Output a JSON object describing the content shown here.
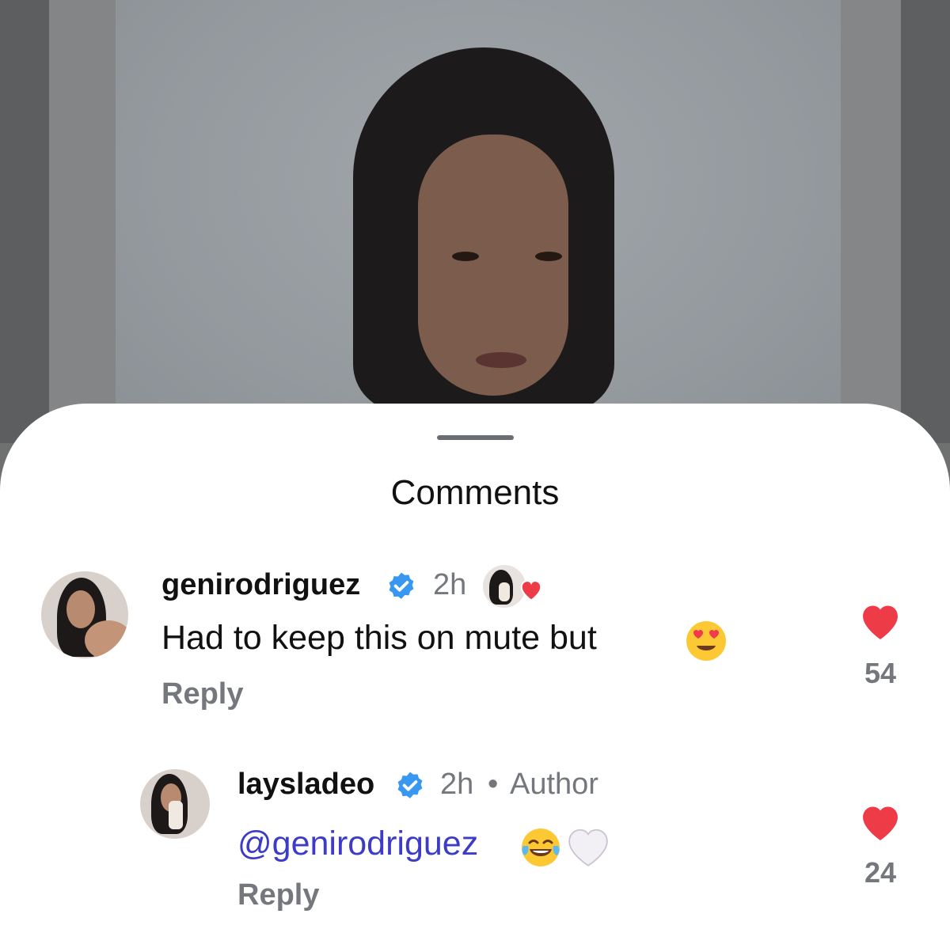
{
  "sheet": {
    "title": "Comments"
  },
  "comments": [
    {
      "username": "genirodriguez",
      "time": "2h",
      "text": "Had to keep this on mute but",
      "emoji": "heart-eyes-emoji",
      "reply_label": "Reply",
      "likes": "54",
      "liked_by_creator": true
    },
    {
      "username": "laysladeo",
      "time": "2h",
      "separator": "•",
      "author_label": "Author",
      "mention": "@genirodriguez",
      "emoji": [
        "tears-of-joy-emoji",
        "white-heart-emoji"
      ],
      "reply_label": "Reply",
      "likes": "24"
    }
  ],
  "colors": {
    "like_red": "#ed3b48",
    "verified_blue": "#3897f0",
    "mention": "#3d3cc6"
  }
}
